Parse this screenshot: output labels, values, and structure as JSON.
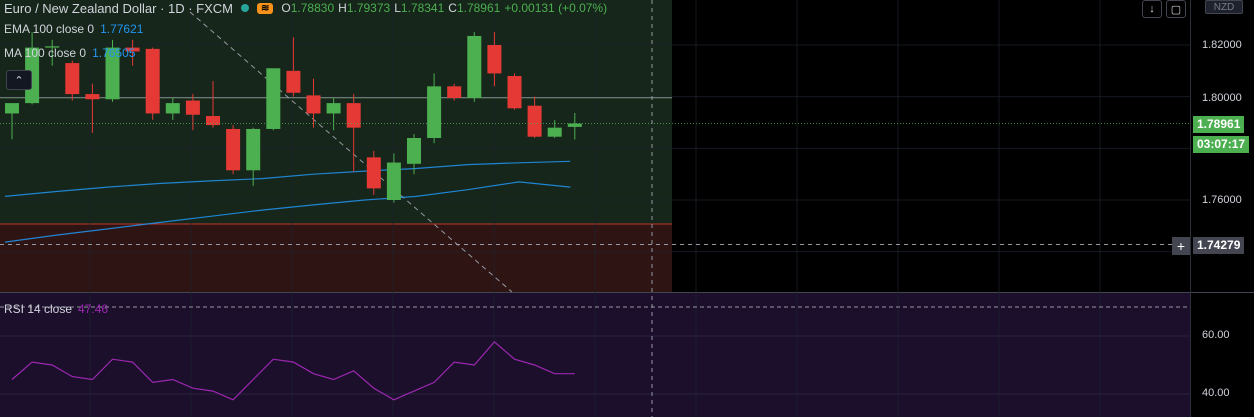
{
  "header": {
    "symbol": "Euro / New Zealand Dollar · 1D · FXCM",
    "flag": "≋",
    "ohlc": [
      {
        "k": "O",
        "v": "1.78830"
      },
      {
        "k": "H",
        "v": "1.79373"
      },
      {
        "k": "L",
        "v": "1.78341"
      },
      {
        "k": "C",
        "v": "1.78961"
      },
      {
        "k": "",
        "v": "+0.00131 (+0.07%)"
      }
    ]
  },
  "legend": {
    "ema": {
      "label": "EMA 100 close 0",
      "value": "1.77621"
    },
    "ma": {
      "label": "MA 100 close 0",
      "value": "1.76505"
    },
    "rsi": {
      "label": "RSI 14 close",
      "value": "47.46"
    }
  },
  "toolbar": {
    "down_icon": "↓",
    "restore_icon": "▢",
    "currency": "NZD",
    "collapse_icon": "⌃"
  },
  "price_axis": {
    "ticks": [
      "1.82000",
      "1.80000",
      "1.78961",
      "1.76000",
      "1.74279"
    ],
    "last_price": "1.78961",
    "countdown": "03:07:17",
    "crosshair_price": "1.74279",
    "rsi_ticks": [
      "60.00",
      "40.00"
    ],
    "colors": {
      "last_price": "#4caf50",
      "countdown": "#4caf50",
      "crosshair": "#434651"
    }
  },
  "chart_data": [
    {
      "type": "candlestick",
      "title": "Euro / New Zealand Dollar · 1D · FXCM",
      "ylim": [
        1.735,
        1.832
      ],
      "candles": [
        {
          "o": 1.7935,
          "h": 1.796,
          "l": 1.7835,
          "c": 1.7975
        },
        {
          "o": 1.7975,
          "h": 1.825,
          "l": 1.797,
          "c": 1.819
        },
        {
          "o": 1.819,
          "h": 1.822,
          "l": 1.812,
          "c": 1.8195
        },
        {
          "o": 1.813,
          "h": 1.814,
          "l": 1.7985,
          "c": 1.801
        },
        {
          "o": 1.801,
          "h": 1.805,
          "l": 1.786,
          "c": 1.799
        },
        {
          "o": 1.799,
          "h": 1.822,
          "l": 1.798,
          "c": 1.819
        },
        {
          "o": 1.819,
          "h": 1.822,
          "l": 1.812,
          "c": 1.8175
        },
        {
          "o": 1.8185,
          "h": 1.819,
          "l": 1.791,
          "c": 1.7935
        },
        {
          "o": 1.7935,
          "h": 1.7995,
          "l": 1.791,
          "c": 1.7975
        },
        {
          "o": 1.7985,
          "h": 1.801,
          "l": 1.787,
          "c": 1.793
        },
        {
          "o": 1.7925,
          "h": 1.806,
          "l": 1.788,
          "c": 1.789
        },
        {
          "o": 1.7875,
          "h": 1.789,
          "l": 1.77,
          "c": 1.7715
        },
        {
          "o": 1.7715,
          "h": 1.788,
          "l": 1.7655,
          "c": 1.7875
        },
        {
          "o": 1.7875,
          "h": 1.809,
          "l": 1.787,
          "c": 1.811
        },
        {
          "o": 1.81,
          "h": 1.823,
          "l": 1.8,
          "c": 1.8015
        },
        {
          "o": 1.8005,
          "h": 1.807,
          "l": 1.788,
          "c": 1.7935
        },
        {
          "o": 1.7935,
          "h": 1.7995,
          "l": 1.787,
          "c": 1.7975
        },
        {
          "o": 1.7975,
          "h": 1.801,
          "l": 1.771,
          "c": 1.788
        },
        {
          "o": 1.7765,
          "h": 1.779,
          "l": 1.762,
          "c": 1.7645
        },
        {
          "o": 1.76,
          "h": 1.778,
          "l": 1.759,
          "c": 1.7745
        },
        {
          "o": 1.774,
          "h": 1.7855,
          "l": 1.77,
          "c": 1.784
        },
        {
          "o": 1.784,
          "h": 1.809,
          "l": 1.782,
          "c": 1.804
        },
        {
          "o": 1.804,
          "h": 1.805,
          "l": 1.7985,
          "c": 1.7995
        },
        {
          "o": 1.7995,
          "h": 1.825,
          "l": 1.798,
          "c": 1.8235
        },
        {
          "o": 1.82,
          "h": 1.825,
          "l": 1.804,
          "c": 1.809
        },
        {
          "o": 1.808,
          "h": 1.809,
          "l": 1.795,
          "c": 1.7955
        },
        {
          "o": 1.7965,
          "h": 1.8,
          "l": 1.784,
          "c": 1.7845
        },
        {
          "o": 1.7845,
          "h": 1.791,
          "l": 1.784,
          "c": 1.788
        },
        {
          "o": 1.7883,
          "h": 1.7937,
          "l": 1.7834,
          "c": 1.7896
        }
      ],
      "series": [
        {
          "name": "EMA 100 close 0",
          "color": "#2196f3",
          "x": [
            0,
            10,
            20,
            30,
            40,
            50,
            60,
            70,
            80,
            90,
            100,
            110
          ],
          "values": [
            1.7614,
            1.7633,
            1.765,
            1.7664,
            1.7674,
            1.7683,
            1.77,
            1.7712,
            1.7722,
            1.7737,
            1.7744,
            1.775
          ]
        },
        {
          "name": "MA 100 close 0",
          "color": "#2196f3",
          "x": [
            0,
            10,
            20,
            30,
            40,
            50,
            60,
            70,
            80,
            90,
            100,
            110
          ],
          "values": [
            1.7437,
            1.7464,
            1.7488,
            1.7513,
            1.7537,
            1.7561,
            1.7581,
            1.76,
            1.7614,
            1.764,
            1.767,
            1.765
          ]
        }
      ]
    },
    {
      "type": "line",
      "title": "RSI 14 close",
      "ylim": [
        38,
        74
      ],
      "yticks": [
        60,
        40
      ],
      "series": [
        {
          "name": "RSI 14 close",
          "color": "#9c27b0",
          "values": [
            45,
            51,
            50,
            46,
            45,
            52,
            51,
            44,
            45,
            42,
            41,
            38,
            45,
            52,
            51,
            47,
            45,
            48,
            42,
            38,
            41,
            44,
            51,
            50,
            58,
            52,
            50,
            47,
            47
          ]
        }
      ]
    }
  ]
}
